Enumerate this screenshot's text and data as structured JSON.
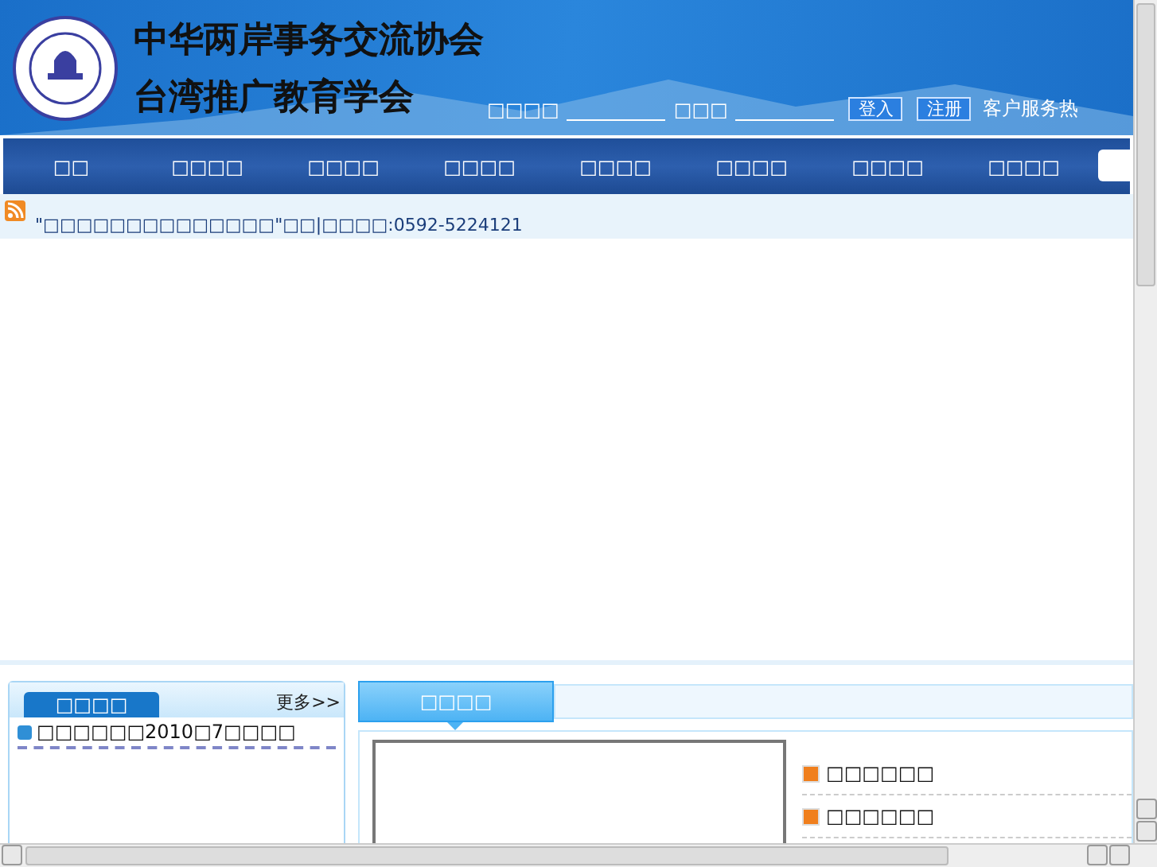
{
  "header": {
    "title_line_1": "中华两岸事务交流协会",
    "title_line_2": "台湾推广教育学会",
    "username_label": "□□□□",
    "password_label": "□□□",
    "login_button": "登入",
    "register_button": "注册",
    "hotline": "客户服务热"
  },
  "nav": [
    {
      "label": "□□"
    },
    {
      "label": "□□□□"
    },
    {
      "label": "□□□□"
    },
    {
      "label": "□□□□"
    },
    {
      "label": "□□□□"
    },
    {
      "label": "□□□□"
    },
    {
      "label": "□□□□"
    },
    {
      "label": "□□□□"
    }
  ],
  "ticker": "\"□□□□□□□□□□□□□□\"□□|□□□□:0592-5224121",
  "left_panel": {
    "tab": "□□□□",
    "more": "更多>>",
    "items": [
      "□□□□□□2010□7□□□□"
    ]
  },
  "right_panel": {
    "tab": "□□□□",
    "items": [
      "□□□□□□",
      "□□□□□□"
    ]
  }
}
